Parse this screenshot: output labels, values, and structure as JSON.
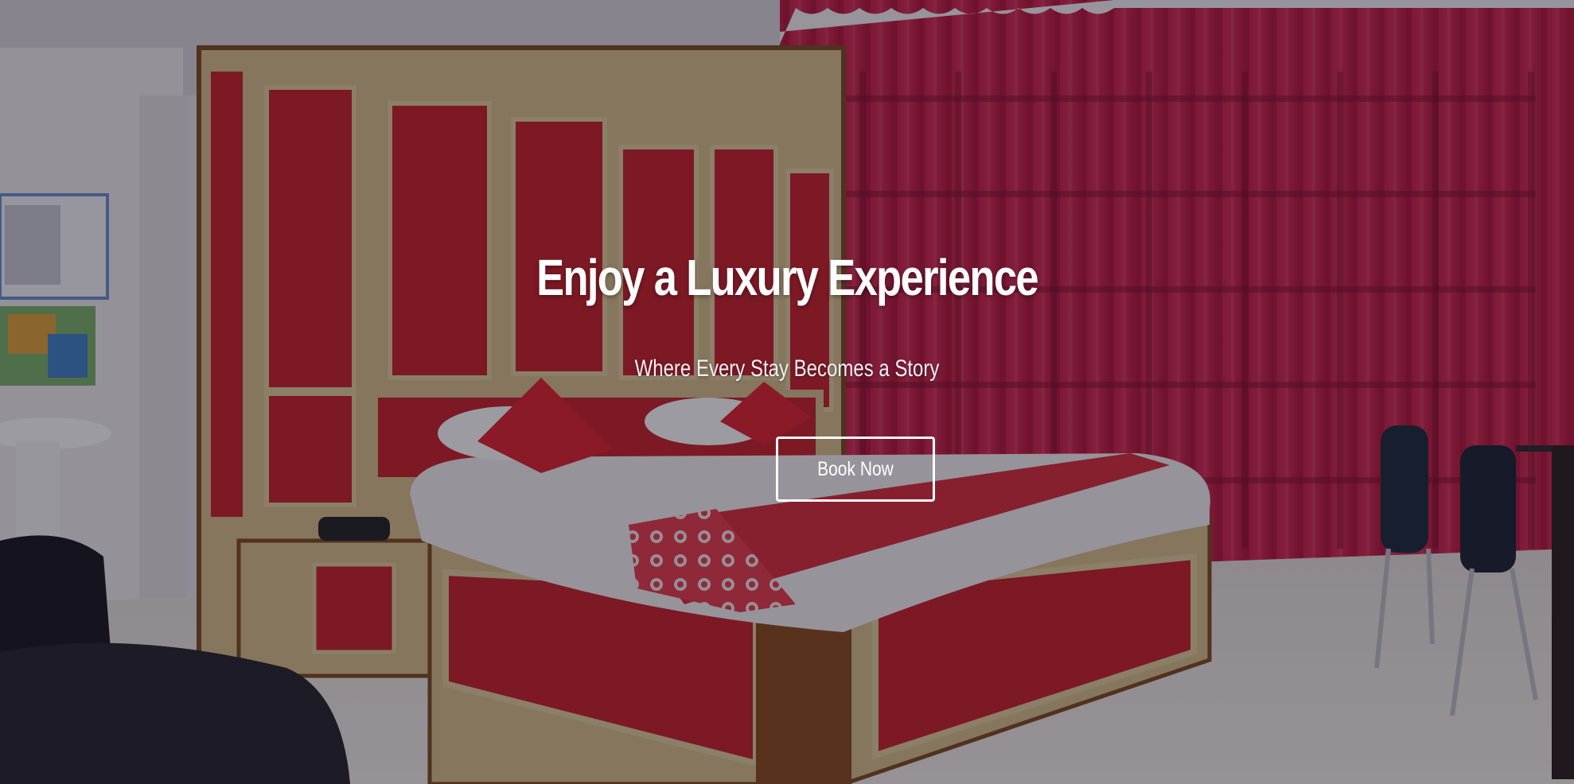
{
  "hero": {
    "title": "Enjoy a Luxury Experience",
    "subtitle": "Where Every Stay Becomes a Story",
    "cta_label": "Book Now",
    "background_image": "hotel-room-with-red-bed-and-red-curtains"
  },
  "colors": {
    "text": "#ffffff",
    "accent_red": "#c41e2a",
    "curtain_red": "#b3163a",
    "wood_cream": "#d8c08a"
  }
}
